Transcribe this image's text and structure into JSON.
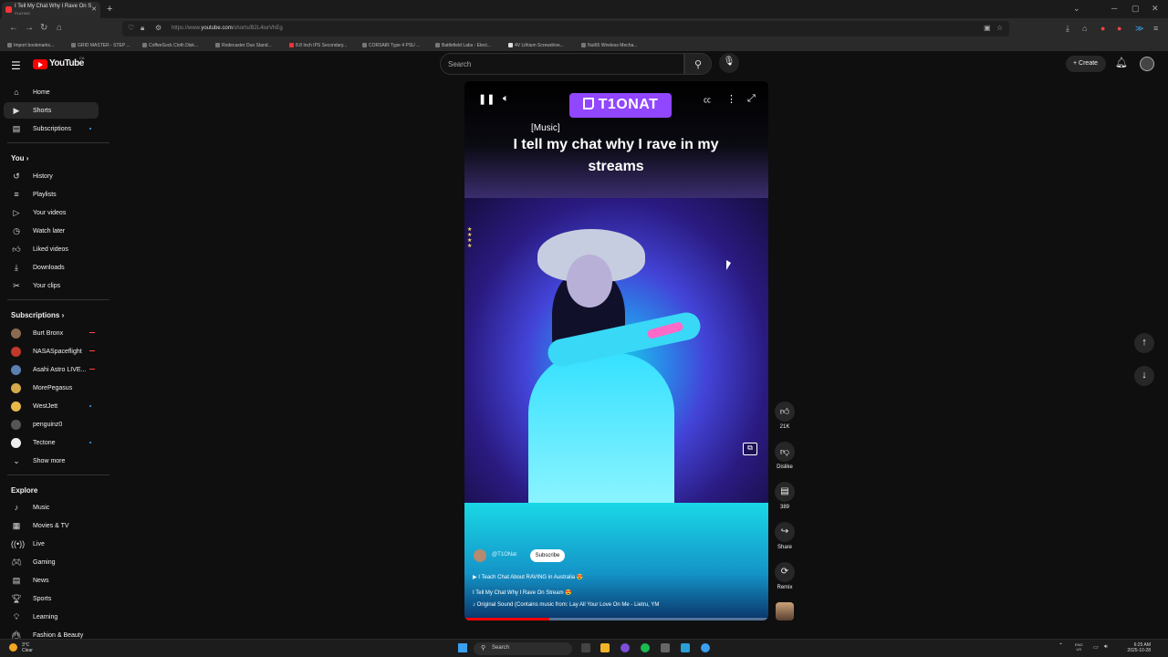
{
  "browser": {
    "tab_title": "I Tell My Chat Why I Rave On S",
    "tab_subtitle": "PLAYING",
    "url_prefix": "https://www.",
    "url_host": "youtube.com",
    "url_path": "/shorts/B2L4iurVhEg",
    "bookmarks": [
      "Import bookmarks...",
      "GRID MASTER - STEP ...",
      "CoffeeSock Cloth Disk...",
      "Rodecaster Duo Stand...",
      "8.8 Inch IPS Secondary...",
      "CORSAIR Type 4 PSU ...",
      "Battlefield Labs - Elect...",
      "4V Lithium Screwdrive...",
      "Nut65 Wireless Mecha..."
    ]
  },
  "header": {
    "logo_text": "YouTube",
    "region": "CA",
    "search_placeholder": "Search",
    "create_label": "Create"
  },
  "sidebar": {
    "main": [
      {
        "label": "Home",
        "icon": "home-icon"
      },
      {
        "label": "Shorts",
        "icon": "shorts-icon"
      },
      {
        "label": "Subscriptions",
        "icon": "subscriptions-icon"
      }
    ],
    "you_heading": "You",
    "you": [
      {
        "label": "History",
        "icon": "history-icon"
      },
      {
        "label": "Playlists",
        "icon": "playlists-icon"
      },
      {
        "label": "Your videos",
        "icon": "your-videos-icon"
      },
      {
        "label": "Watch later",
        "icon": "watch-later-icon"
      },
      {
        "label": "Liked videos",
        "icon": "liked-icon"
      },
      {
        "label": "Downloads",
        "icon": "download-icon"
      },
      {
        "label": "Your clips",
        "icon": "clips-icon"
      }
    ],
    "subs_heading": "Subscriptions",
    "subs": [
      {
        "label": "Burt Bronx",
        "color": "#8a6a50",
        "live": true
      },
      {
        "label": "NASASpaceflight",
        "color": "#c0392b",
        "live": true
      },
      {
        "label": "Asahi Astro LIVE...",
        "color": "#5a7fb0",
        "live": true
      },
      {
        "label": "MorePegasus",
        "color": "#d4a84b",
        "live": false
      },
      {
        "label": "WestJett",
        "color": "#e6b84a",
        "live": false
      },
      {
        "label": "penguinz0",
        "color": "#555555",
        "live": false
      },
      {
        "label": "Tectone",
        "color": "#eeeeee",
        "live": false
      }
    ],
    "show_more": "Show more",
    "explore_heading": "Explore",
    "explore": [
      {
        "label": "Music",
        "icon": "music-icon"
      },
      {
        "label": "Movies & TV",
        "icon": "movies-icon"
      },
      {
        "label": "Live",
        "icon": "live-icon"
      },
      {
        "label": "Gaming",
        "icon": "gaming-icon"
      },
      {
        "label": "News",
        "icon": "news-icon"
      },
      {
        "label": "Sports",
        "icon": "sports-icon"
      },
      {
        "label": "Learning",
        "icon": "learning-icon"
      },
      {
        "label": "Fashion & Beauty",
        "icon": "fashion-icon"
      }
    ]
  },
  "short": {
    "banner_name": "T1ONAT",
    "music_tag": "[Music]",
    "caption": "I tell my chat why I rave in my streams",
    "channel": "@T1ONat",
    "subscribe_label": "Subscribe",
    "linked_video": "I Teach Chat About RAVING in Australia 😍",
    "title": "I Tell My Chat Why I Rave On Stream 😍",
    "sound": "Original Sound (Contains music from: Lay All Your Love On Me - Lietru, YM",
    "progress": 0.28
  },
  "actions": {
    "likes": "21K",
    "dislike": "Dislike",
    "comments": "389",
    "share": "Share",
    "remix": "Remix"
  },
  "taskbar": {
    "temp": "3°C",
    "weather": "Clear",
    "search": "Search",
    "lang1": "ENG",
    "lang2": "US",
    "time": "6:25 AM",
    "date": "2025-10-28"
  }
}
